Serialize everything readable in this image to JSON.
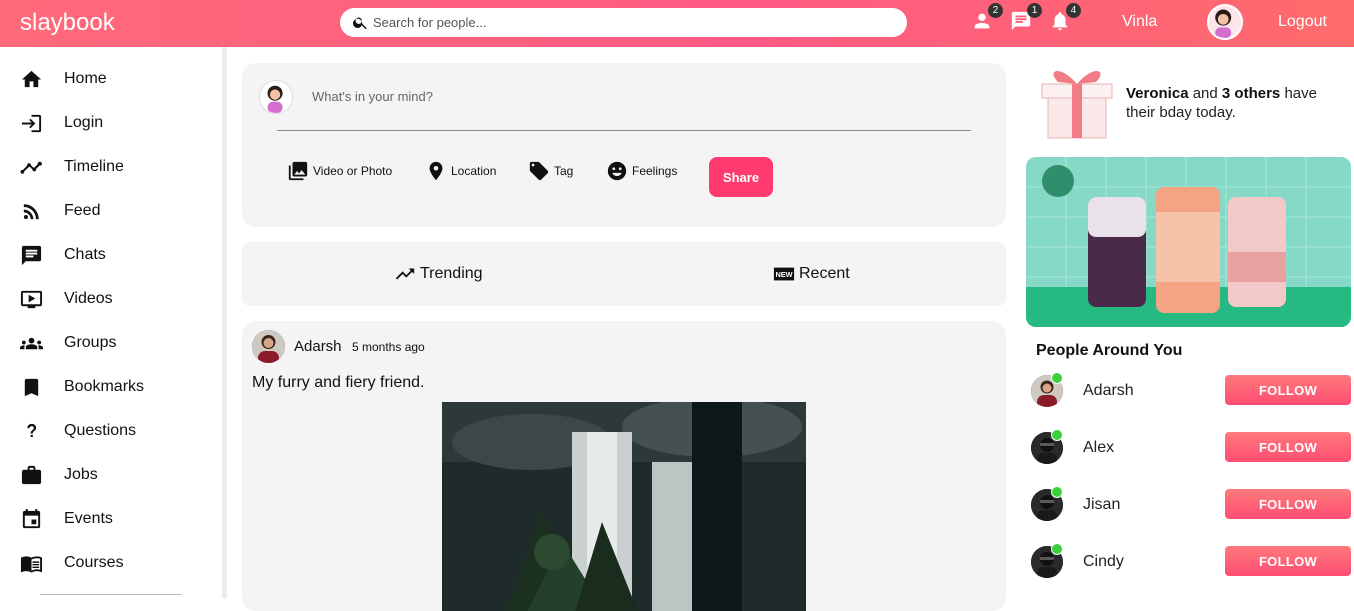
{
  "header": {
    "logo": "slaybook",
    "search_placeholder": "Search for people...",
    "badges": {
      "friends": "2",
      "messages": "1",
      "notifications": "4"
    },
    "username": "Vinla",
    "logout": "Logout",
    "icons": [
      "person-icon",
      "chat-icon",
      "bell-icon"
    ]
  },
  "sidebar": {
    "items": [
      {
        "label": "Home",
        "icon": "home-icon"
      },
      {
        "label": "Login",
        "icon": "login-icon"
      },
      {
        "label": "Timeline",
        "icon": "timeline-icon"
      },
      {
        "label": "Feed",
        "icon": "rss-icon"
      },
      {
        "label": "Chats",
        "icon": "chat-icon"
      },
      {
        "label": "Videos",
        "icon": "video-icon"
      },
      {
        "label": "Groups",
        "icon": "groups-icon"
      },
      {
        "label": "Bookmarks",
        "icon": "bookmark-icon"
      },
      {
        "label": "Questions",
        "icon": "question-icon"
      },
      {
        "label": "Jobs",
        "icon": "briefcase-icon"
      },
      {
        "label": "Events",
        "icon": "calendar-icon"
      },
      {
        "label": "Courses",
        "icon": "book-icon"
      }
    ]
  },
  "composer": {
    "placeholder": "What's in your mind?",
    "options": {
      "media": "Video or Photo",
      "location": "Location",
      "tag": "Tag",
      "feelings": "Feelings"
    },
    "share": "Share"
  },
  "tabs": {
    "trending": "Trending",
    "recent": "Recent"
  },
  "post": {
    "author": "Adarsh",
    "time": "5 months ago",
    "text": "My furry and fiery friend."
  },
  "birthday": {
    "name": "Veronica",
    "and": " and ",
    "others": "3 others",
    "rest": " have their bday today."
  },
  "people_around": {
    "title": "People Around You",
    "follow_label": "FOLLOW",
    "people": [
      {
        "name": "Adarsh"
      },
      {
        "name": "Alex"
      },
      {
        "name": "Jisan"
      },
      {
        "name": "Cindy"
      }
    ]
  },
  "colors": {
    "brand": "#ff5a84",
    "button": "#ff3a6e",
    "online": "#3bd13b"
  }
}
